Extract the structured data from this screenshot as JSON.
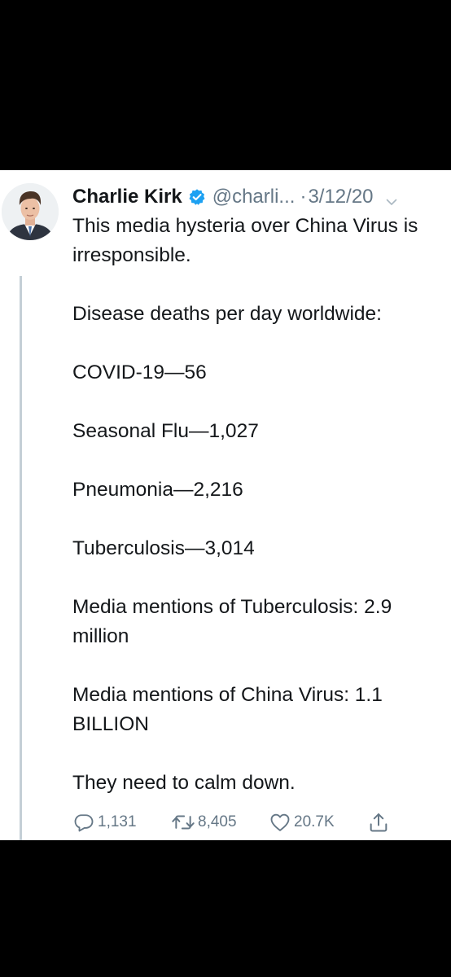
{
  "tweet": {
    "author_name": "Charlie Kirk",
    "verified_icon": "verified-badge-icon",
    "handle": "@charli...",
    "time_separator": "·",
    "timestamp": "3/12/20",
    "menu_icon": "chevron-down-icon",
    "avatar_icon": "profile-photo",
    "body": [
      "This media hysteria over China Virus is irresponsible.",
      "Disease deaths per day worldwide:",
      "COVID-19—56",
      "Seasonal Flu—1,027",
      "Pneumonia—2,216",
      "Tuberculosis—3,014",
      "Media mentions of Tuberculosis: 2.9 million",
      "Media mentions of China Virus: 1.1 BILLION",
      "They need to calm down."
    ],
    "actions": {
      "reply": {
        "icon": "reply-icon",
        "count": "1,131"
      },
      "retweet": {
        "icon": "retweet-icon",
        "count": "8,405"
      },
      "like": {
        "icon": "heart-icon",
        "count": "20.7K"
      },
      "share": {
        "icon": "share-icon"
      }
    }
  },
  "colors": {
    "background": "#000000",
    "card": "#ffffff",
    "text": "#14171a",
    "secondary_text": "#657786",
    "verified_blue": "#1da1f2",
    "thread_line": "#c4cfd6"
  }
}
